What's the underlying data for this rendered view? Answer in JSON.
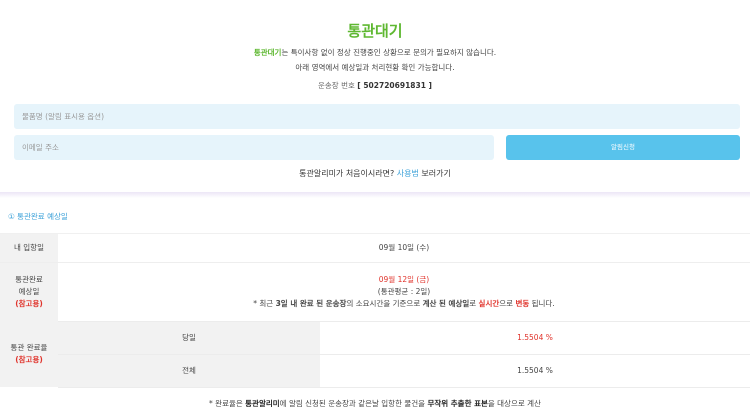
{
  "header": {
    "title": "통관대기",
    "desc_highlight": "통관대기",
    "desc1_rest": "는 특이사항 없이 정상 진행중인 상황으로 문의가 필요하지 않습니다.",
    "desc2": "아래 영역에서 예상일과 처리현황 확인 가능합니다.",
    "tracking_label": "운송장 번호",
    "tracking_number": "[ 502720691831 ]"
  },
  "form": {
    "product_placeholder": "물품명 (알림 표시용 옵션)",
    "email_placeholder": "이메일 주소",
    "submit_label": "알림신청",
    "first_time_prefix": "통관알리미가 처음이시라면?",
    "first_time_link": "사용법",
    "first_time_suffix": "보러가기"
  },
  "section": {
    "label": "① 통관완료 예상일"
  },
  "table": {
    "arrival_label": "내 입항일",
    "arrival_value": "09월 10일 (수)",
    "expected_label_1": "통관완료",
    "expected_label_2": "예상일",
    "expected_label_3": "(참고용)",
    "expected_date": "09월 12일 (금)",
    "expected_avg": "(통관평균 : 2일)",
    "expected_note_1": "* 최근 ",
    "expected_note_2": "3일 내 완료 된 운송장",
    "expected_note_3": "의 소요시간을 기준으로 ",
    "expected_note_4": "계산 된 예상일",
    "expected_note_5": "로 ",
    "expected_note_6": "실시간",
    "expected_note_7": "으로 ",
    "expected_note_8": "변동",
    "expected_note_9": " 됩니다.",
    "rate_label_1": "통관 완료율",
    "rate_label_2": "(참고용)",
    "today_label": "당일",
    "today_value": "1.5504 %",
    "total_label": "전체",
    "total_value": "1.5504 %"
  },
  "footnote": {
    "p1": "* 완료율은 ",
    "p2": "통관알리미",
    "p3": "에 알림 신청된 운송장과 같은날 입항한 물건을 ",
    "p4": "무작위 추출한 표본",
    "p5": "을 대상으로 계산"
  }
}
